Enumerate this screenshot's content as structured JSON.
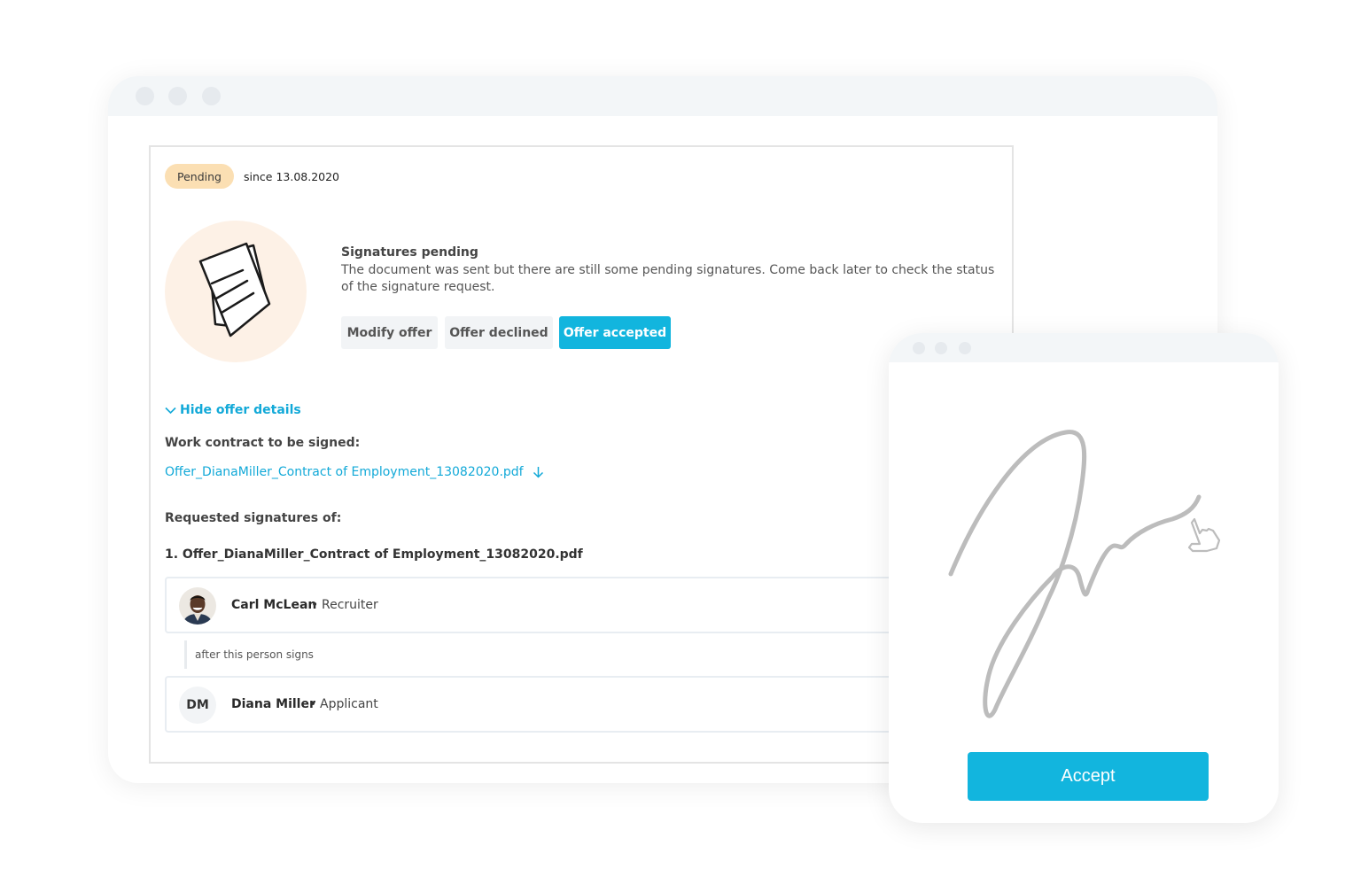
{
  "main_window": {
    "status": {
      "badge": "Pending",
      "since": "since 13.08.2020",
      "badge_color": "#fbdfb3"
    },
    "illustration_icon": "documents-icon",
    "signature_status": {
      "title": "Signatures pending",
      "description": "The document was sent but there are still some pending signatures. Come back later to check the status of the signature request."
    },
    "actions": {
      "modify": "Modify offer",
      "declined": "Offer declined",
      "accepted": "Offer accepted",
      "accent_color": "#12b5de"
    },
    "details_toggle": "Hide offer details",
    "work_contract_label": "Work contract to be signed:",
    "contract_file": "Offer_DianaMiller_Contract of Employment_13082020.pdf",
    "requested_label": "Requested signatures of:",
    "requested_file": "1. Offer_DianaMiller_Contract of Employment_13082020.pdf",
    "signers": [
      {
        "name": "Carl McLean",
        "role": "Recruiter",
        "separator": "•",
        "avatar": "photo"
      },
      {
        "name": "Diana Miller",
        "role": "Applicant",
        "separator": "•",
        "initials": "DM"
      }
    ],
    "after_note": "after this person signs"
  },
  "signature_window": {
    "accept_label": "Accept",
    "cursor_icon": "hand-pointer-icon"
  }
}
